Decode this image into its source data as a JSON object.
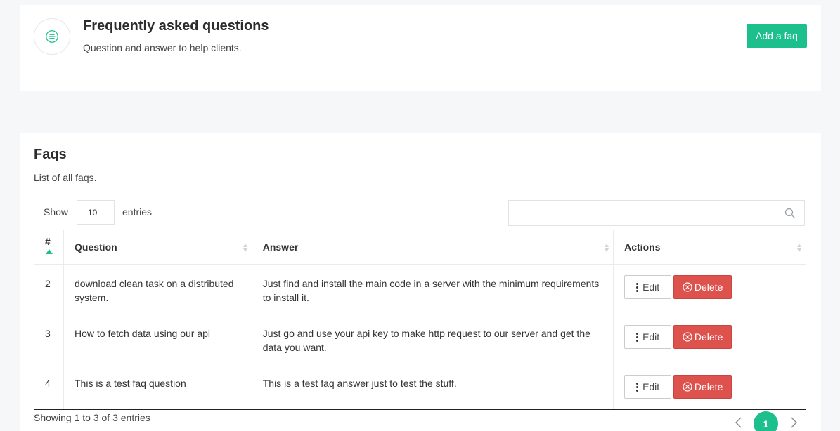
{
  "header": {
    "title": "Frequently asked questions",
    "subtitle": "Question and answer to help clients.",
    "add_button": "Add a faq"
  },
  "faqs": {
    "title": "Faqs",
    "subtitle": "List of all faqs.",
    "show_label": "Show",
    "entries_value": "10",
    "entries_label": "entries",
    "search_placeholder": "",
    "columns": [
      "#",
      "Question",
      "Answer",
      "Actions"
    ],
    "rows": [
      {
        "id": "2",
        "question": "download clean task on a distributed system.",
        "answer": "Just find and install the main code in a server with the minimum requirements to install it.",
        "edit": "Edit",
        "delete": "Delete"
      },
      {
        "id": "3",
        "question": "How to fetch data using our api",
        "answer": "Just go and use your api key to make http request to our server and get the data you want.",
        "edit": "Edit",
        "delete": "Delete"
      },
      {
        "id": "4",
        "question": "This is a test faq question",
        "answer": "This is a test faq answer just to test the stuff.",
        "edit": "Edit",
        "delete": "Delete"
      }
    ],
    "footer_info": "Showing 1 to 3 of 3 entries",
    "current_page": "1"
  },
  "colors": {
    "accent": "#1dbf8c",
    "danger": "#de524e"
  }
}
